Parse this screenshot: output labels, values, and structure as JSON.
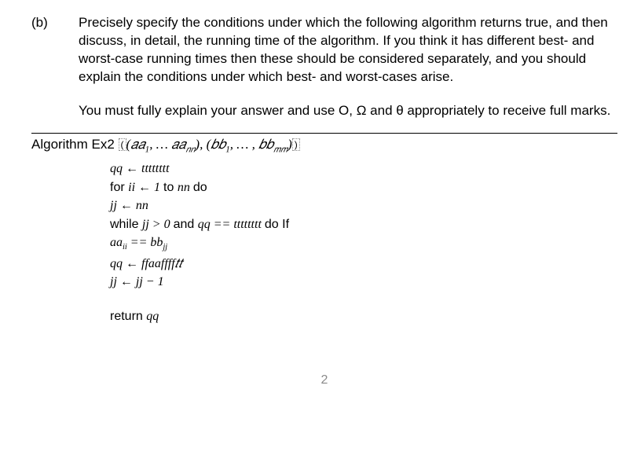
{
  "question": {
    "label": "(b)",
    "para1": "Precisely specify the conditions under which the following algorithm returns true, and then discuss, in detail, the running time of the algorithm. If you think it has different best- and worst-case running times then these should be considered separately, and you should explain the conditions under which best- and worst-cases arise.",
    "para2": "You must fully explain your answer and use O, Ω and θ appropriately to receive full marks."
  },
  "algorithm": {
    "title_prefix": "Algorithm Ex2 ",
    "title_args_a": "(𝑎𝑎",
    "title_args_a1": "1",
    "title_args_a_mid": ", … 𝑎𝑎",
    "title_args_an": "𝑛𝑛",
    "title_args_sep": "), (𝑏𝑏",
    "title_args_b1": "1",
    "title_args_b_mid": ", … , 𝑏𝑏",
    "title_args_bm": "𝑚𝑚",
    "title_args_close": ")",
    "l1": "qq ← tttttttt",
    "l2_for": "for ",
    "l2_var": "ii",
    "l2_arrow": " ← 1 ",
    "l2_to": "to ",
    "l2_n": "nn ",
    "l2_do": "do",
    "l3": "jj ← nn",
    "l4_while": "while ",
    "l4_cond": "jj > 0 ",
    "l4_and": "and ",
    "l4_cond2": "qq  == tttttttt ",
    "l4_do": "do ",
    "l4_if": "If",
    "l5_a": "aa",
    "l5_i": "ii",
    "l5_eq": " == ",
    "l5_b": "bb",
    "l5_j": "jj",
    "l6": "qq ← ffaaffff𝑡𝑡",
    "l7": "jj ← jj − 1",
    "l8_return": "return ",
    "l8_var": "qq"
  },
  "page_number": "2"
}
